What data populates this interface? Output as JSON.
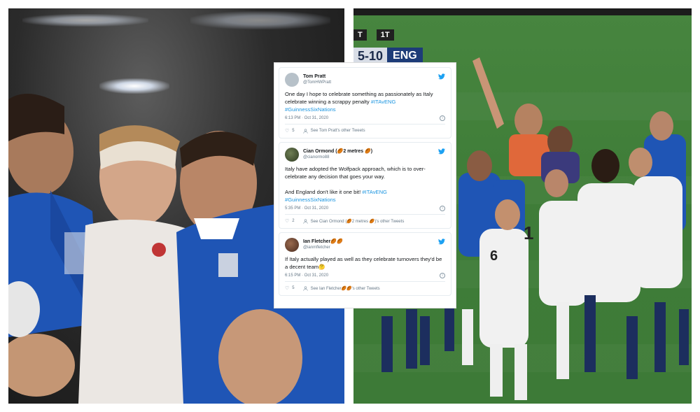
{
  "scoreboard": {
    "clock_left": "T",
    "clock_right": "1T",
    "score": "5-10",
    "team": "ENG"
  },
  "tweets": [
    {
      "display_name": "Tom Pratt",
      "handle": "@TomHWPratt",
      "text_plain": "One day I hope to celebrate something as passionately as Italy celebrate winning a scrappy penalty ",
      "hashtags": "#ITAvENG\n#GuinnessSixNations",
      "timestamp": "6:13 PM · Oct 31, 2020",
      "likes": "5",
      "other_tweets": "See Tom Pratt's other Tweets",
      "avatar_icon": "avatar-silhouette-icon"
    },
    {
      "display_name": "Cian Ormond (🏉2 metres 🏉)",
      "handle": "@cianormo88",
      "text_plain": "Italy have adopted the Wolfpack approach, which is to over-celebrate any decision that goes your way.\n\nAnd England don't like it one bit! ",
      "hashtags": "#ITAvENG\n#GuinnessSixNations",
      "timestamp": "5:35 PM · Oct 31, 2020",
      "likes": "2",
      "other_tweets": "See Cian Ormond (🏉2 metres 🏉)'s other Tweets",
      "avatar_icon": "avatar-photo-icon"
    },
    {
      "display_name": "Ian Fletcher🏉🏉",
      "handle": "@ianmfletcher",
      "text_plain": "If Italy actually played as well as they celebrate turnovers they'd be a decent team🤔",
      "hashtags": "",
      "timestamp": "6:15 PM · Oct 31, 2020",
      "likes": "5",
      "other_tweets": "See Ian Fletcher🏉🏉's other Tweets",
      "avatar_icon": "avatar-photo-icon"
    }
  ],
  "colors": {
    "twitter_blue": "#1da1f2",
    "hashtag": "#1b95e0",
    "italy_blue": "#1f55b5",
    "england_white": "#f2f2f2",
    "pitch_green": "#3f7d38"
  }
}
